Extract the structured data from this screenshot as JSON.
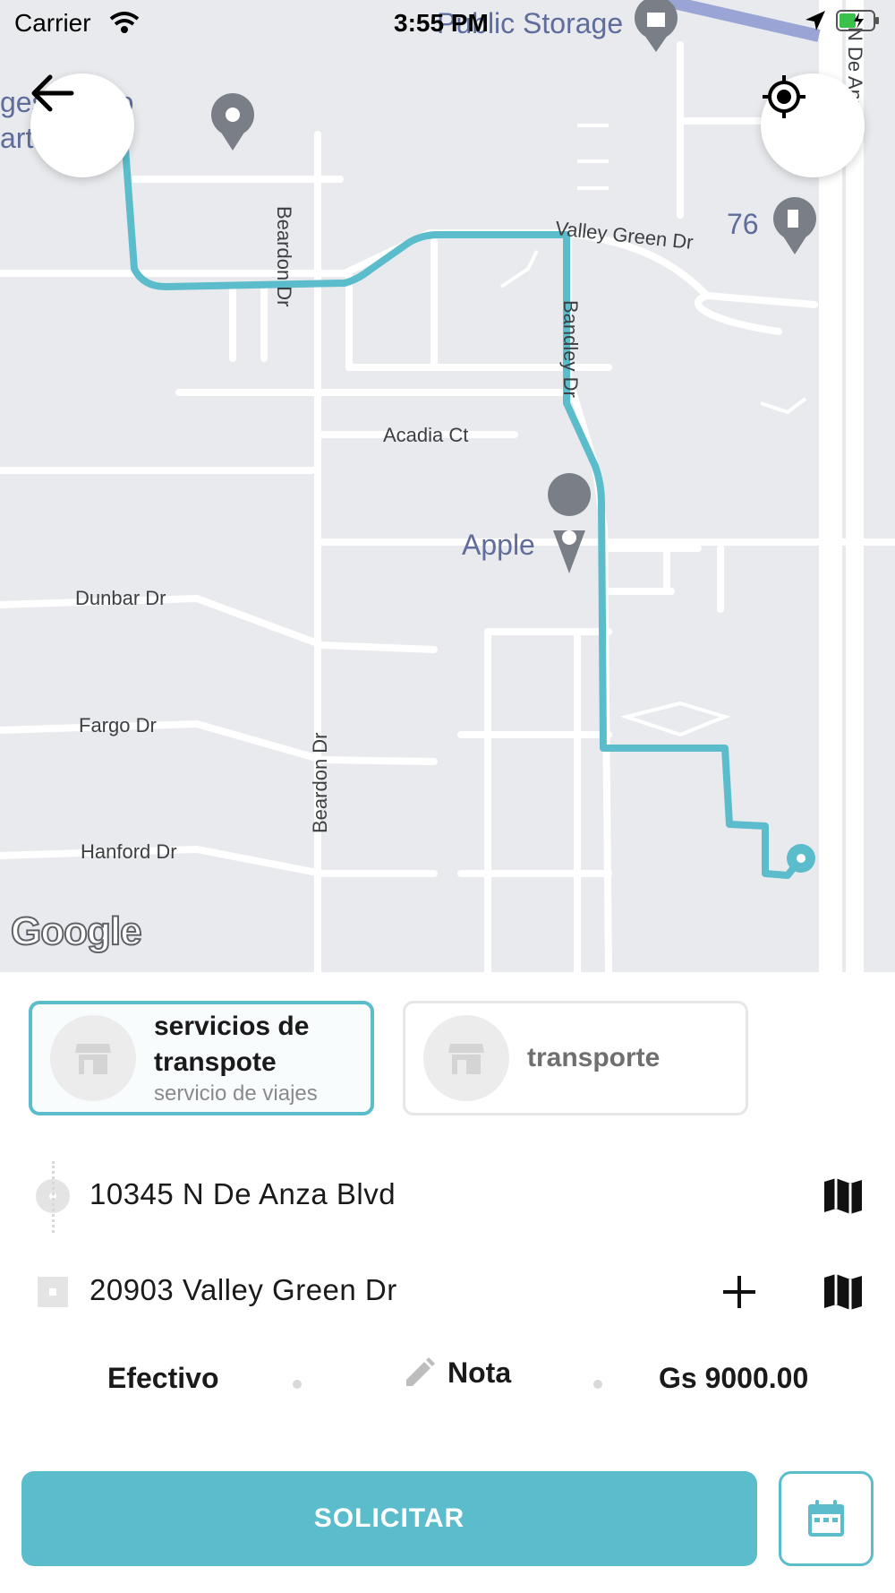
{
  "status_bar": {
    "carrier": "Carrier",
    "time": "3:55 PM"
  },
  "map": {
    "street_labels": {
      "beardon_top": "Beardon Dr",
      "beardon_bottom": "Beardon Dr",
      "valley_green": "Valley Green Dr",
      "bandley": "Bandley Dr",
      "acadia": "Acadia Ct",
      "dunbar": "Dunbar Dr",
      "fargo": "Fargo Dr",
      "hanford": "Hanford Dr",
      "de_anza": "N De Anza"
    },
    "poi_labels": {
      "apple": "Apple",
      "station_76": "76",
      "public_storage": "Public Storage",
      "cupertino_line1": "ges  ertino",
      "cupertino_line2": "art   omes"
    },
    "route_color": "#5bbccb",
    "attribution": "Google"
  },
  "services": [
    {
      "title": "servicios de transpote",
      "subtitle": "servicio de viajes",
      "selected": true,
      "icon": "store-icon"
    },
    {
      "title": "transporte",
      "subtitle": "",
      "selected": false,
      "icon": "store-icon"
    }
  ],
  "route": {
    "origin": "10345 N De Anza Blvd",
    "destination": "20903 Valley Green Dr"
  },
  "payment": {
    "method": "Efectivo",
    "note_label": "Nota",
    "price": "Gs 9000.00"
  },
  "actions": {
    "request_label": "SOLICITAR"
  },
  "colors": {
    "accent": "#5bbccb",
    "map_background": "#e8eaed"
  }
}
